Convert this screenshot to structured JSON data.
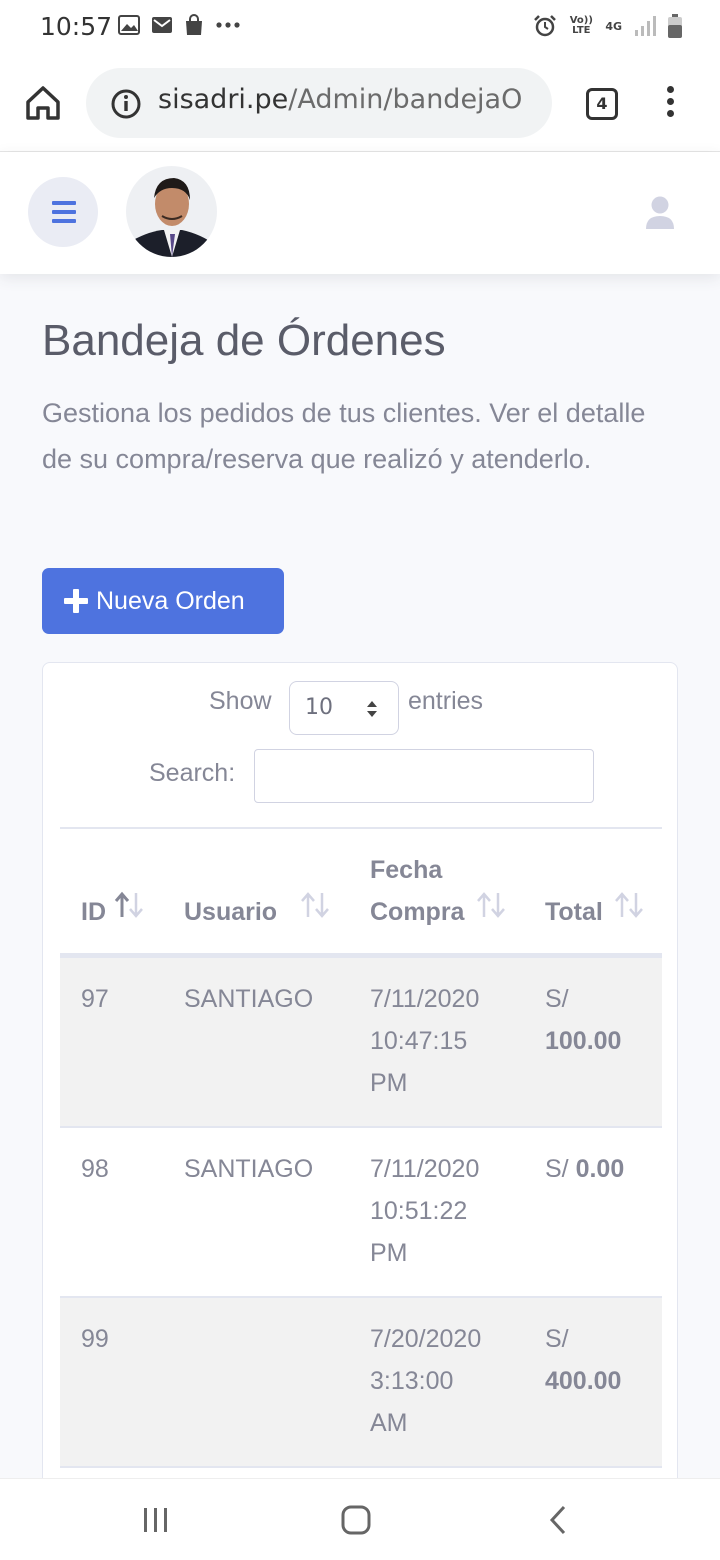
{
  "status_bar": {
    "time": "10:57",
    "network_label": "Vo)) LTE",
    "network_type": "4G"
  },
  "browser": {
    "url_host": "sisadri.pe",
    "url_path": "/Admin/bandejaO",
    "tab_count": "4"
  },
  "page": {
    "title": "Bandeja de Órdenes",
    "description": "Gestiona los pedidos de tus clientes. Ver el detalle de su compra/reserva que realizó y atenderlo.",
    "new_order_label": "Nueva Orden"
  },
  "table_controls": {
    "show_label": "Show",
    "entries_value": "10",
    "entries_label": "entries",
    "search_label": "Search:",
    "search_value": ""
  },
  "table": {
    "headers": {
      "id": "ID",
      "usuario": "Usuario",
      "fecha_line1": "Fecha",
      "fecha_line2": "Compra",
      "total": "Total"
    },
    "rows": [
      {
        "id": "97",
        "usuario": "SANTIAGO",
        "date": "7/11/2020",
        "time": "10:47:15",
        "ampm": "PM",
        "currency": "S/",
        "amount": "100.00"
      },
      {
        "id": "98",
        "usuario": "SANTIAGO",
        "date": "7/11/2020",
        "time": "10:51:22",
        "ampm": "PM",
        "currency": "S/",
        "amount": "0.00"
      },
      {
        "id": "99",
        "usuario": "",
        "date": "7/20/2020",
        "time": "3:13:00",
        "ampm": "AM",
        "currency": "S/",
        "amount": "400.00"
      }
    ]
  },
  "colors": {
    "primary": "#4e73df",
    "text": "#858796",
    "heading": "#5a5c69"
  }
}
